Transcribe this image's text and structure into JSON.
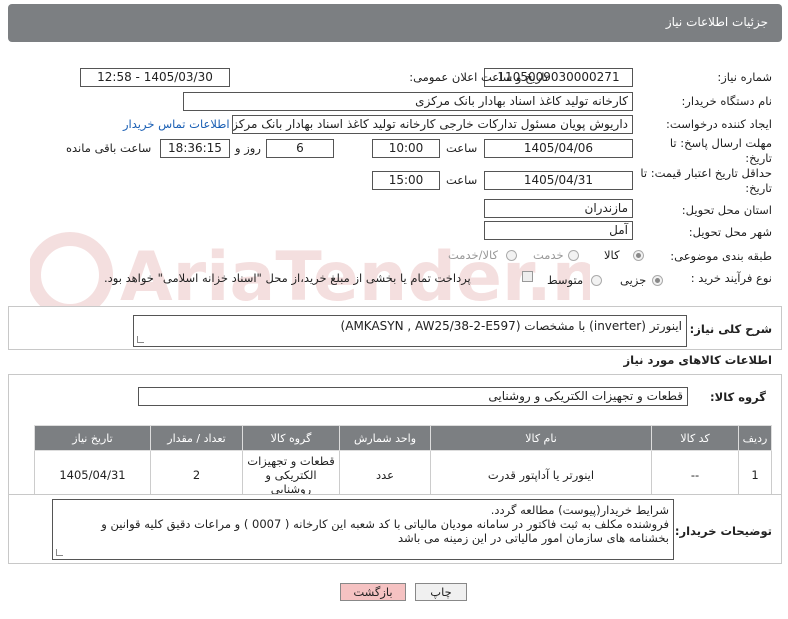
{
  "header": {
    "title": "جزئیات اطلاعات نیاز"
  },
  "form": {
    "need_number_label": "شماره نیاز:",
    "need_number": "1105009030000271",
    "announce_label": "تاریخ و ساعت اعلان عمومی:",
    "announce_value": "1405/03/30 - 12:58",
    "buyer_org_label": "نام دستگاه خریدار:",
    "buyer_org": "کارخانه تولید کاغذ اسناد بهادار بانک مرکزی",
    "requester_label": "ایجاد کننده درخواست:",
    "requester": "داریوش  پویان مسئول تدارکات خارجی کارخانه تولید کاغذ اسناد بهادار بانک مرکزی",
    "contact_link": "اطلاعات تماس خریدار",
    "reply_deadline_label": "مهلت ارسال پاسخ: تا تاریخ:",
    "reply_date": "1405/04/06",
    "time_label": "ساعت",
    "reply_time": "10:00",
    "days_value": "6",
    "days_label": "روز و",
    "remaining_time": "18:36:15",
    "remaining_label": "ساعت باقی مانده",
    "min_validity_label": "حداقل تاریخ اعتبار قیمت: تا تاریخ:",
    "validity_date": "1405/04/31",
    "validity_time": "15:00",
    "province_label": "استان محل تحویل:",
    "province": "مازندران",
    "city_label": "شهر محل تحویل:",
    "city": "آمل",
    "category_label": "طبقه بندی موضوعی:",
    "category_options": [
      "کالا",
      "خدمت",
      "کالا/خدمت"
    ],
    "purchase_type_label": "نوع فرآیند خرید :",
    "purchase_options": [
      "جزیی",
      "متوسط"
    ],
    "payment_note": "پرداخت تمام یا بخشی از مبلغ خرید،از محل \"اسناد خزانه اسلامی\" خواهد بود."
  },
  "description": {
    "label": "شرح کلی نیاز:",
    "text": "اینورتر (inverter) با مشخصات (AMKASYN , AW25/38-2-E597)"
  },
  "goods": {
    "section_title": "اطلاعات کالاهای مورد نیاز",
    "group_label": "گروه کالا:",
    "group_value": "قطعات و تجهیزات الکتریکی و روشنایی",
    "columns": [
      "ردیف",
      "کد کالا",
      "نام کالا",
      "واحد شمارش",
      "گروه کالا",
      "تعداد / مقدار",
      "تاریخ نیاز"
    ],
    "rows": [
      {
        "row": "1",
        "code": "--",
        "name": "اینورتر یا آداپتور قدرت",
        "unit": "عدد",
        "group": "قطعات و تجهیزات الکتریکی و روشنایی",
        "qty": "2",
        "date": "1405/04/31"
      }
    ]
  },
  "buyer_notes": {
    "label": "توضیحات خریدار:",
    "line1": "شرایط  خریدار(پیوست) مطالعه گردد.",
    "line2": "فروشنده مکلف به ثبت فاکتور در سامانه مودیان مالیاتی با کد شعبه این کارخانه ( 0007 ) و مراعات دقیق کلیه قوانین و",
    "line3": "بخشنامه های سازمان امور مالیاتی در این زمینه می باشد"
  },
  "buttons": {
    "print": "چاپ",
    "back": "بازگشت"
  },
  "colors": {
    "header_bg": "#7c7f82",
    "link": "#1a5fb4",
    "back_btn": "#f5c2c2"
  },
  "watermark": {
    "text": "AriaTender.net"
  }
}
